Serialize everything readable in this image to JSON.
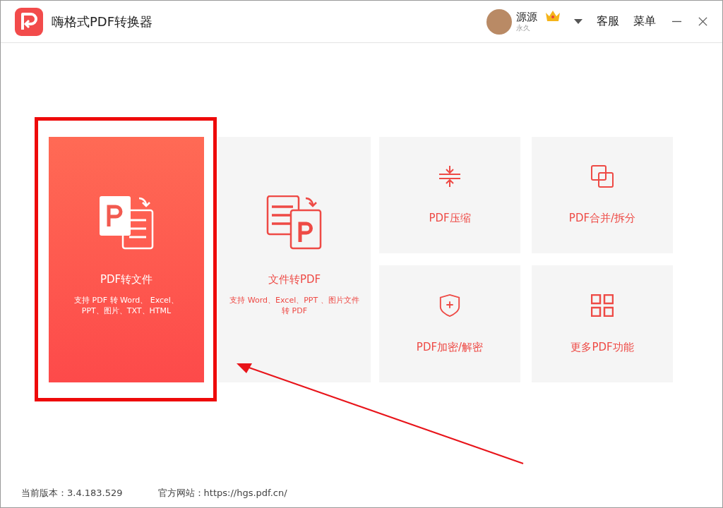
{
  "window": {
    "title": "嗨格式PDF转换器"
  },
  "user": {
    "name": "源源",
    "membership": "永久"
  },
  "header_links": [
    "客服",
    "菜单"
  ],
  "cards": [
    {
      "kind": "large",
      "title": "PDF转文件",
      "description": "支持 PDF 转 Word、 Excel、PPT、图片、TXT、HTML",
      "selected": true
    },
    {
      "kind": "large",
      "title": "文件转PDF",
      "description": "支持 Word、Excel、PPT 、图片文件转 PDF",
      "selected": false
    },
    {
      "kind": "small",
      "title": "PDF压缩",
      "selected": false
    },
    {
      "kind": "small",
      "title": "PDF合并/拆分",
      "selected": false
    },
    {
      "kind": "small",
      "title": "PDF加密/解密",
      "selected": false
    },
    {
      "kind": "small",
      "title": "更多PDF功能",
      "selected": false
    }
  ],
  "status_bar": {
    "version": "当前版本：3.4.183.529",
    "website": "官方网站：https://hgs.pdf.cn/"
  }
}
